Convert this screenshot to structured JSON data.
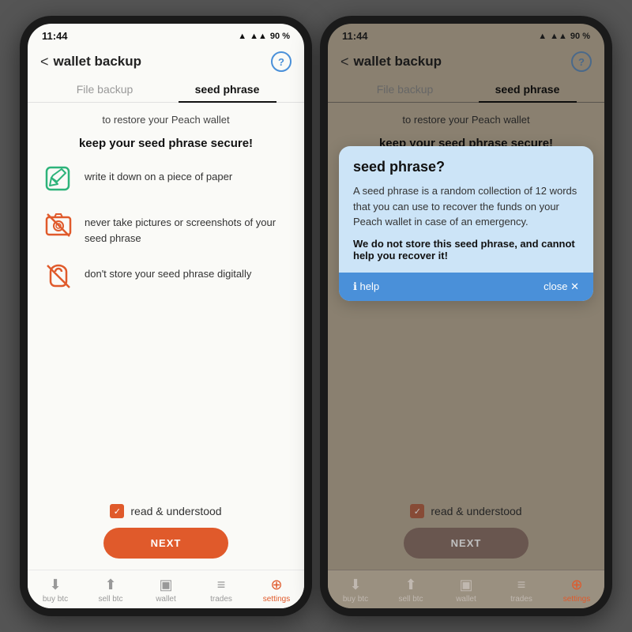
{
  "phones": [
    {
      "id": "phone-left",
      "status": {
        "time": "11:44",
        "signal": "▲▲▲",
        "wifi": "▲",
        "battery": "90 %"
      },
      "header": {
        "back": "<",
        "title": "wallet backup",
        "help": "?"
      },
      "tabs": [
        {
          "label": "File backup",
          "active": false
        },
        {
          "label": "seed phrase",
          "active": true
        }
      ],
      "subtitle": "to restore your Peach wallet",
      "section_title": "keep your seed phrase secure!",
      "tips": [
        {
          "icon": "✏️",
          "type": "green",
          "text": "write it down on a piece of paper"
        },
        {
          "icon": "📷",
          "type": "red",
          "text": "never take pictures or screenshots of your seed phrase"
        },
        {
          "icon": "🔔",
          "type": "red",
          "text": "don't store your seed phrase digitally"
        }
      ],
      "checkbox_label": "read & understood",
      "next_label": "NEXT",
      "nav": [
        {
          "icon": "⬇",
          "label": "buy btc",
          "active": false
        },
        {
          "icon": "⬆",
          "label": "sell btc",
          "active": false
        },
        {
          "icon": "▣",
          "label": "wallet",
          "active": false
        },
        {
          "icon": "≡",
          "label": "trades",
          "active": false
        },
        {
          "icon": "⊕",
          "label": "settings",
          "active": true
        }
      ]
    },
    {
      "id": "phone-right",
      "status": {
        "time": "11:44",
        "signal": "▲▲▲",
        "wifi": "▲",
        "battery": "90 %"
      },
      "header": {
        "back": "<",
        "title": "wallet backup",
        "help": "?"
      },
      "tabs": [
        {
          "label": "File backup",
          "active": false
        },
        {
          "label": "seed phrase",
          "active": true
        }
      ],
      "subtitle": "to restore your Peach wallet",
      "section_title": "keep your seed phrase secure!",
      "tips": [
        {
          "icon": "✏️",
          "type": "green",
          "text": "write it down on a piece of paper"
        },
        {
          "icon": "📷",
          "type": "red",
          "text": "never take pictures or screenshots of your seed phrase"
        },
        {
          "icon": "🔔",
          "type": "red",
          "text": "don't store your seed phrase digitally"
        }
      ],
      "checkbox_label": "read & understood",
      "next_label": "NEXT",
      "nav": [
        {
          "icon": "⬇",
          "label": "buy btc",
          "active": false
        },
        {
          "icon": "⬆",
          "label": "sell btc",
          "active": false
        },
        {
          "icon": "▣",
          "label": "wallet",
          "active": false
        },
        {
          "icon": "≡",
          "label": "trades",
          "active": false
        },
        {
          "icon": "⊕",
          "label": "settings",
          "active": true
        }
      ],
      "tooltip": {
        "title": "seed phrase?",
        "body": "A seed phrase is a random collection of 12 words that you can use to recover the funds on your Peach wallet in case of an emergency.",
        "bold": "We do not store this seed phrase, and cannot help you recover it!",
        "help_label": "ℹ help",
        "close_label": "close ✕"
      }
    }
  ]
}
